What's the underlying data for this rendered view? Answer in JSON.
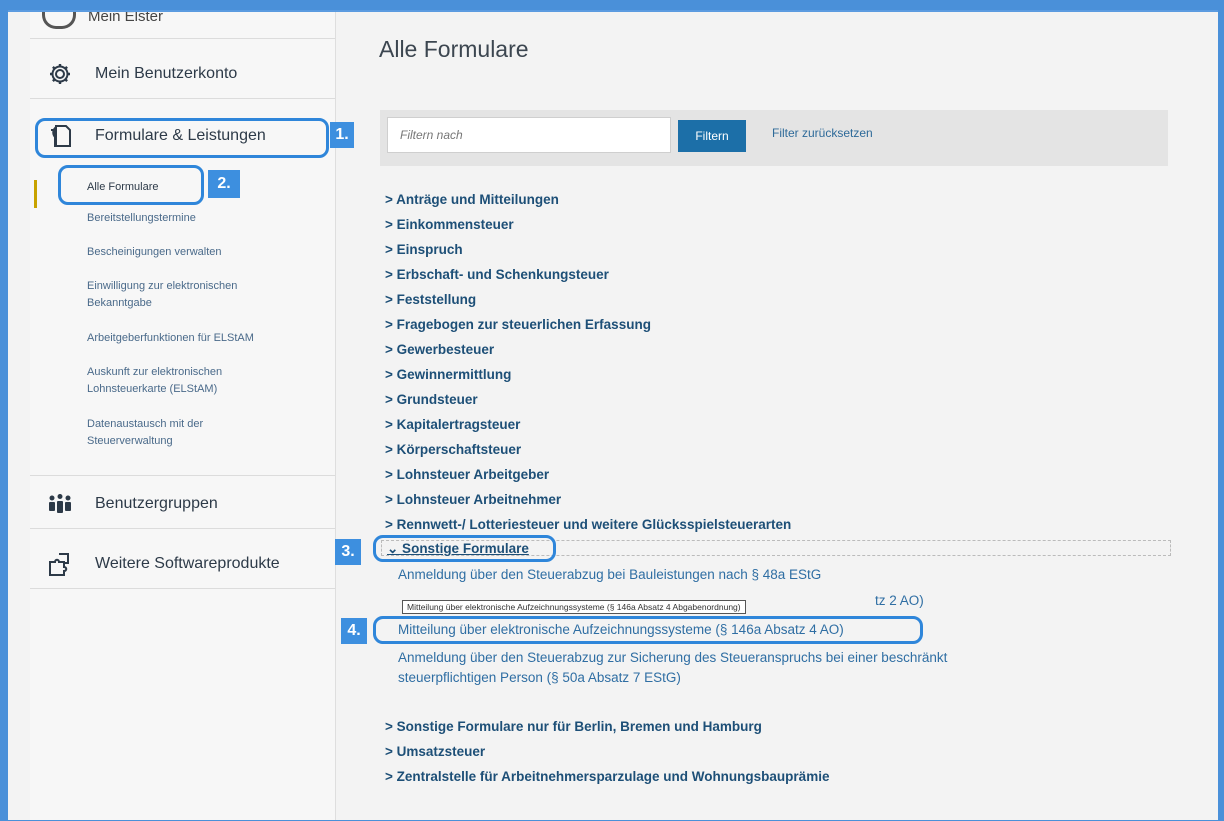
{
  "sidebar": {
    "partial_top_label": "Mein Elster",
    "items": [
      {
        "label": "Mein Benutzerkonto",
        "icon": "gear-icon"
      },
      {
        "label": "Formulare & Leistungen",
        "icon": "forms-icon"
      },
      {
        "label": "Benutzergruppen",
        "icon": "users-icon"
      },
      {
        "label": "Weitere Softwareprodukte",
        "icon": "puzzle-icon"
      }
    ],
    "sub_items": [
      "Alle Formulare",
      "Bereitstellungstermine",
      "Bescheinigungen verwalten",
      "Einwilligung zur elektronischen Bekanntgabe",
      "Arbeitgeberfunktionen für ELStAM",
      "Auskunft zur elektronischen Lohnsteuerkarte (ELStAM)",
      "Datenaustausch mit der Steuerverwaltung"
    ]
  },
  "main": {
    "title": "Alle Formulare",
    "filter": {
      "placeholder": "Filtern nach",
      "button": "Filtern",
      "reset": "Filter zurücksetzen"
    },
    "categories_top": [
      "> Anträge und Mitteilungen",
      "> Einkommensteuer",
      "> Einspruch",
      "> Erbschaft- und Schenkungsteuer",
      "> Feststellung",
      "> Fragebogen zur steuerlichen Erfassung",
      "> Gewerbesteuer",
      "> Gewinnermittlung",
      "> Grundsteuer",
      "> Kapitalertragsteuer",
      "> Körperschaftsteuer",
      "> Lohnsteuer Arbeitgeber",
      "> Lohnsteuer Arbeitnehmer",
      "> Rennwett-/ Lotteriesteuer und weitere Glücksspielsteuerarten"
    ],
    "expanded_category": "⌄ Sonstige Formulare",
    "forms": [
      "Anmeldung über den Steuerabzug bei Bauleistungen nach § 48a EStG",
      "tz 2 AO)",
      "Mitteilung über elektronische Aufzeichnungssysteme (§ 146a Absatz 4 AO)",
      "Anmeldung über den Steuerabzug zur Sicherung des Steueranspruchs bei einer beschränkt",
      "steuerpflichtigen Person (§ 50a Absatz 7 EStG)"
    ],
    "tooltip": "Mitteilung über elektronische Aufzeichnungssysteme (§ 146a Absatz 4 Abgabenordnung)",
    "categories_bottom": [
      "> Sonstige Formulare nur für Berlin, Bremen und Hamburg",
      "> Umsatzsteuer",
      "> Zentralstelle für Arbeitnehmersparzulage und Wohnungsbauprämie"
    ]
  },
  "annotations": [
    "1.",
    "2.",
    "3.",
    "4."
  ]
}
